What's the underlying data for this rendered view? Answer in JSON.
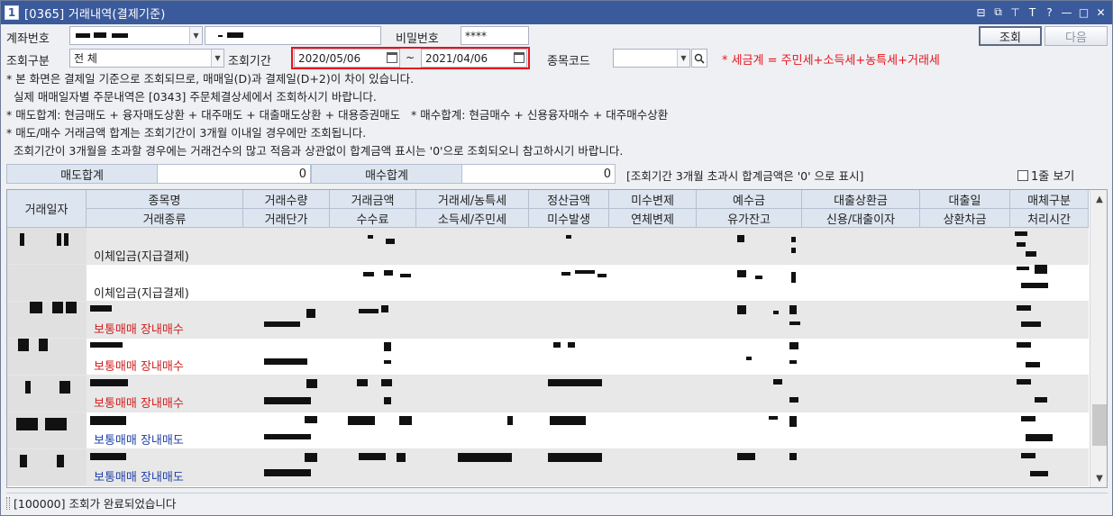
{
  "window": {
    "title": "[0365] 거래내역(결제기준)",
    "number_badge": "1",
    "controls": [
      "⊟",
      "⧉",
      "⊤",
      "T",
      "?",
      "—",
      "□",
      "✕"
    ]
  },
  "form": {
    "account_label": "계좌번호",
    "password_label": "비밀번호",
    "password_value": "****",
    "inquiry_type_label": "조회구분",
    "inquiry_type_value": "전 체",
    "period_label": "조회기간",
    "date_from": "2020/05/06",
    "date_sep": "~",
    "date_to": "2021/04/06",
    "stock_code_label": "종목코드",
    "tax_note": "* 세금계 = 주민세+소득세+농특세+거래세",
    "search_button": "조회",
    "next_button": "다음"
  },
  "notes": [
    "* 본 화면은 결제일 기준으로 조회되므로, 매매일(D)과 결제일(D+2)이 차이 있습니다.",
    "  실제 매매일자별 주문내역은 [0343] 주문체결상세에서 조회하시기 바랍니다.",
    "* 매도합계: 현금매도 + 융자매도상환 + 대주매도 + 대출매도상환 + 대용증권매도   * 매수합계: 현금매수 + 신용융자매수 + 대주매수상환",
    "* 매도/매수 거래금액 합계는 조회기간이 3개월 이내일 경우에만 조회됩니다.",
    "  조회기간이 3개월을 초과할 경우에는 거래건수의 많고 적음과 상관없이 합계금액 표시는 '0'으로 조회되오니 참고하시기 바랍니다."
  ],
  "summary": {
    "sell_total_label": "매도합계",
    "sell_total_value": "0",
    "buy_total_label": "매수합계",
    "buy_total_value": "0",
    "note": "[조회기간 3개월 초과시 합계금액은 '0' 으로 표시]",
    "one_line_label": "1줄 보기"
  },
  "grid": {
    "headers": {
      "date": "거래일자",
      "top": [
        "종목명",
        "거래수량",
        "거래금액",
        "거래세/농특세",
        "정산금액",
        "미수변제",
        "예수금",
        "대출상환금",
        "대출일",
        "매체구분"
      ],
      "bottom": [
        "거래종류",
        "거래단가",
        "수수료",
        "소득세/주민세",
        "미수발생",
        "연체변제",
        "유가잔고",
        "신용/대출이자",
        "상환차금",
        "처리시간"
      ]
    },
    "rows": [
      {
        "type": "이체입금(지급결제)",
        "color": "black"
      },
      {
        "type": "이체입금(지급결제)",
        "color": "black"
      },
      {
        "type": "보통매매 장내매수",
        "color": "red"
      },
      {
        "type": "보통매매 장내매수",
        "color": "red"
      },
      {
        "type": "보통매매 장내매수",
        "color": "red"
      },
      {
        "type": "보통매매 장내매도",
        "color": "blue"
      },
      {
        "type": "보통매매 장내매도",
        "color": "blue"
      }
    ]
  },
  "status": {
    "message": "[100000] 조회가 완료되었습니다"
  }
}
